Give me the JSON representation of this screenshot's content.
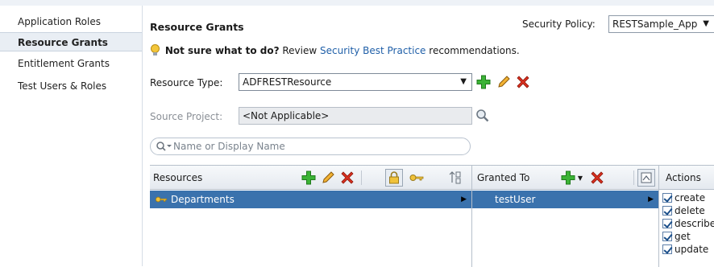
{
  "nav": {
    "items": [
      {
        "label": "Application Roles"
      },
      {
        "label": "Resource Grants"
      },
      {
        "label": "Entitlement Grants"
      },
      {
        "label": "Test Users & Roles"
      }
    ],
    "selected": "Resource Grants"
  },
  "header": {
    "title": "Resource Grants",
    "policy_label": "Security Policy:",
    "policy_value": "RESTSample_App"
  },
  "hint": {
    "question": "Not sure what to do?",
    "review": "Review",
    "link": "Security Best Practice",
    "tail": "recommendations."
  },
  "resource_type": {
    "label": "Resource Type:",
    "value": "ADFRESTResource"
  },
  "source_project": {
    "label": "Source Project:",
    "value": "<Not Applicable>"
  },
  "search": {
    "placeholder": "Name or Display Name"
  },
  "table": {
    "resources_header": "Resources",
    "granted_header": "Granted To",
    "actions_header": "Actions",
    "resource_rows": [
      "Departments"
    ],
    "granted_rows": [
      "testUser"
    ],
    "actions": [
      "create",
      "delete",
      "describe",
      "get",
      "update"
    ]
  },
  "colors": {
    "selection": "#3a72ad",
    "link": "#1f5fa8",
    "add_green": "#2ea82a",
    "delete_red": "#d0271d"
  }
}
